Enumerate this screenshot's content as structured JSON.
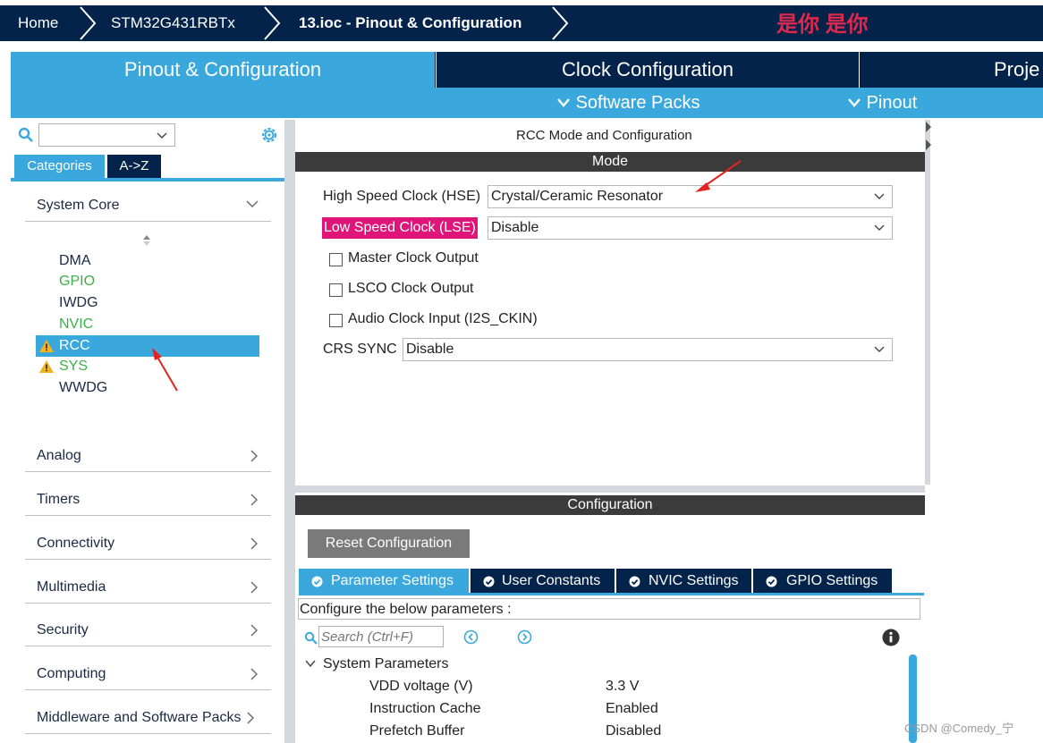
{
  "breadcrumb": {
    "home": "Home",
    "device": "STM32G431RBTx",
    "file": "13.ioc - Pinout & Configuration"
  },
  "overlay_text": "是你 是你",
  "main_tabs": [
    "Pinout & Configuration",
    "Clock Configuration",
    "Proje"
  ],
  "sub_menu": {
    "software_packs": "Software Packs",
    "pinout": "Pinout"
  },
  "left": {
    "search_value": "",
    "tabs": {
      "categories": "Categories",
      "az": "A->Z"
    },
    "system_core": "System Core",
    "peripherals": [
      {
        "name": "DMA",
        "color": "#1a2a44",
        "warning": false
      },
      {
        "name": "GPIO",
        "color": "#3dae4a",
        "warning": false
      },
      {
        "name": "IWDG",
        "color": "#1a2a44",
        "warning": false
      },
      {
        "name": "NVIC",
        "color": "#3dae4a",
        "warning": false
      },
      {
        "name": "RCC",
        "color": "#ffffff",
        "warning": true,
        "selected": true
      },
      {
        "name": "SYS",
        "color": "#3dae4a",
        "warning": true
      },
      {
        "name": "WWDG",
        "color": "#1a2a44",
        "warning": false
      }
    ],
    "categories": [
      "Analog",
      "Timers",
      "Connectivity",
      "Multimedia",
      "Security",
      "Computing",
      "Middleware and Software Packs"
    ]
  },
  "rcc": {
    "title": "RCC Mode and Configuration",
    "mode_header": "Mode",
    "hse_label": "High Speed Clock (HSE)",
    "hse_value": "Crystal/Ceramic Resonator",
    "lse_label": "Low Speed Clock (LSE)",
    "lse_value": "Disable",
    "checkboxes": [
      "Master Clock Output",
      "LSCO Clock Output",
      "Audio Clock Input (I2S_CKIN)"
    ],
    "crs_label": "CRS SYNC",
    "crs_value": "Disable"
  },
  "config": {
    "header": "Configuration",
    "reset_button": "Reset Configuration",
    "tabs": [
      "Parameter Settings",
      "User Constants",
      "NVIC Settings",
      "GPIO Settings"
    ],
    "hint": "Configure the below parameters :",
    "search_placeholder": "Search (Ctrl+F)",
    "group": "System Parameters",
    "params": [
      {
        "name": "VDD voltage (V)",
        "value": "3.3 V"
      },
      {
        "name": "Instruction Cache",
        "value": "Enabled"
      },
      {
        "name": "Prefetch Buffer",
        "value": "Disabled"
      }
    ]
  },
  "watermark": "CSDN @Comedy_宁",
  "colors": {
    "navy": "#03234b",
    "accent": "#3aa8dc",
    "lse_highlight": "#e0157a",
    "annotation_arrow": "#e3231f"
  }
}
